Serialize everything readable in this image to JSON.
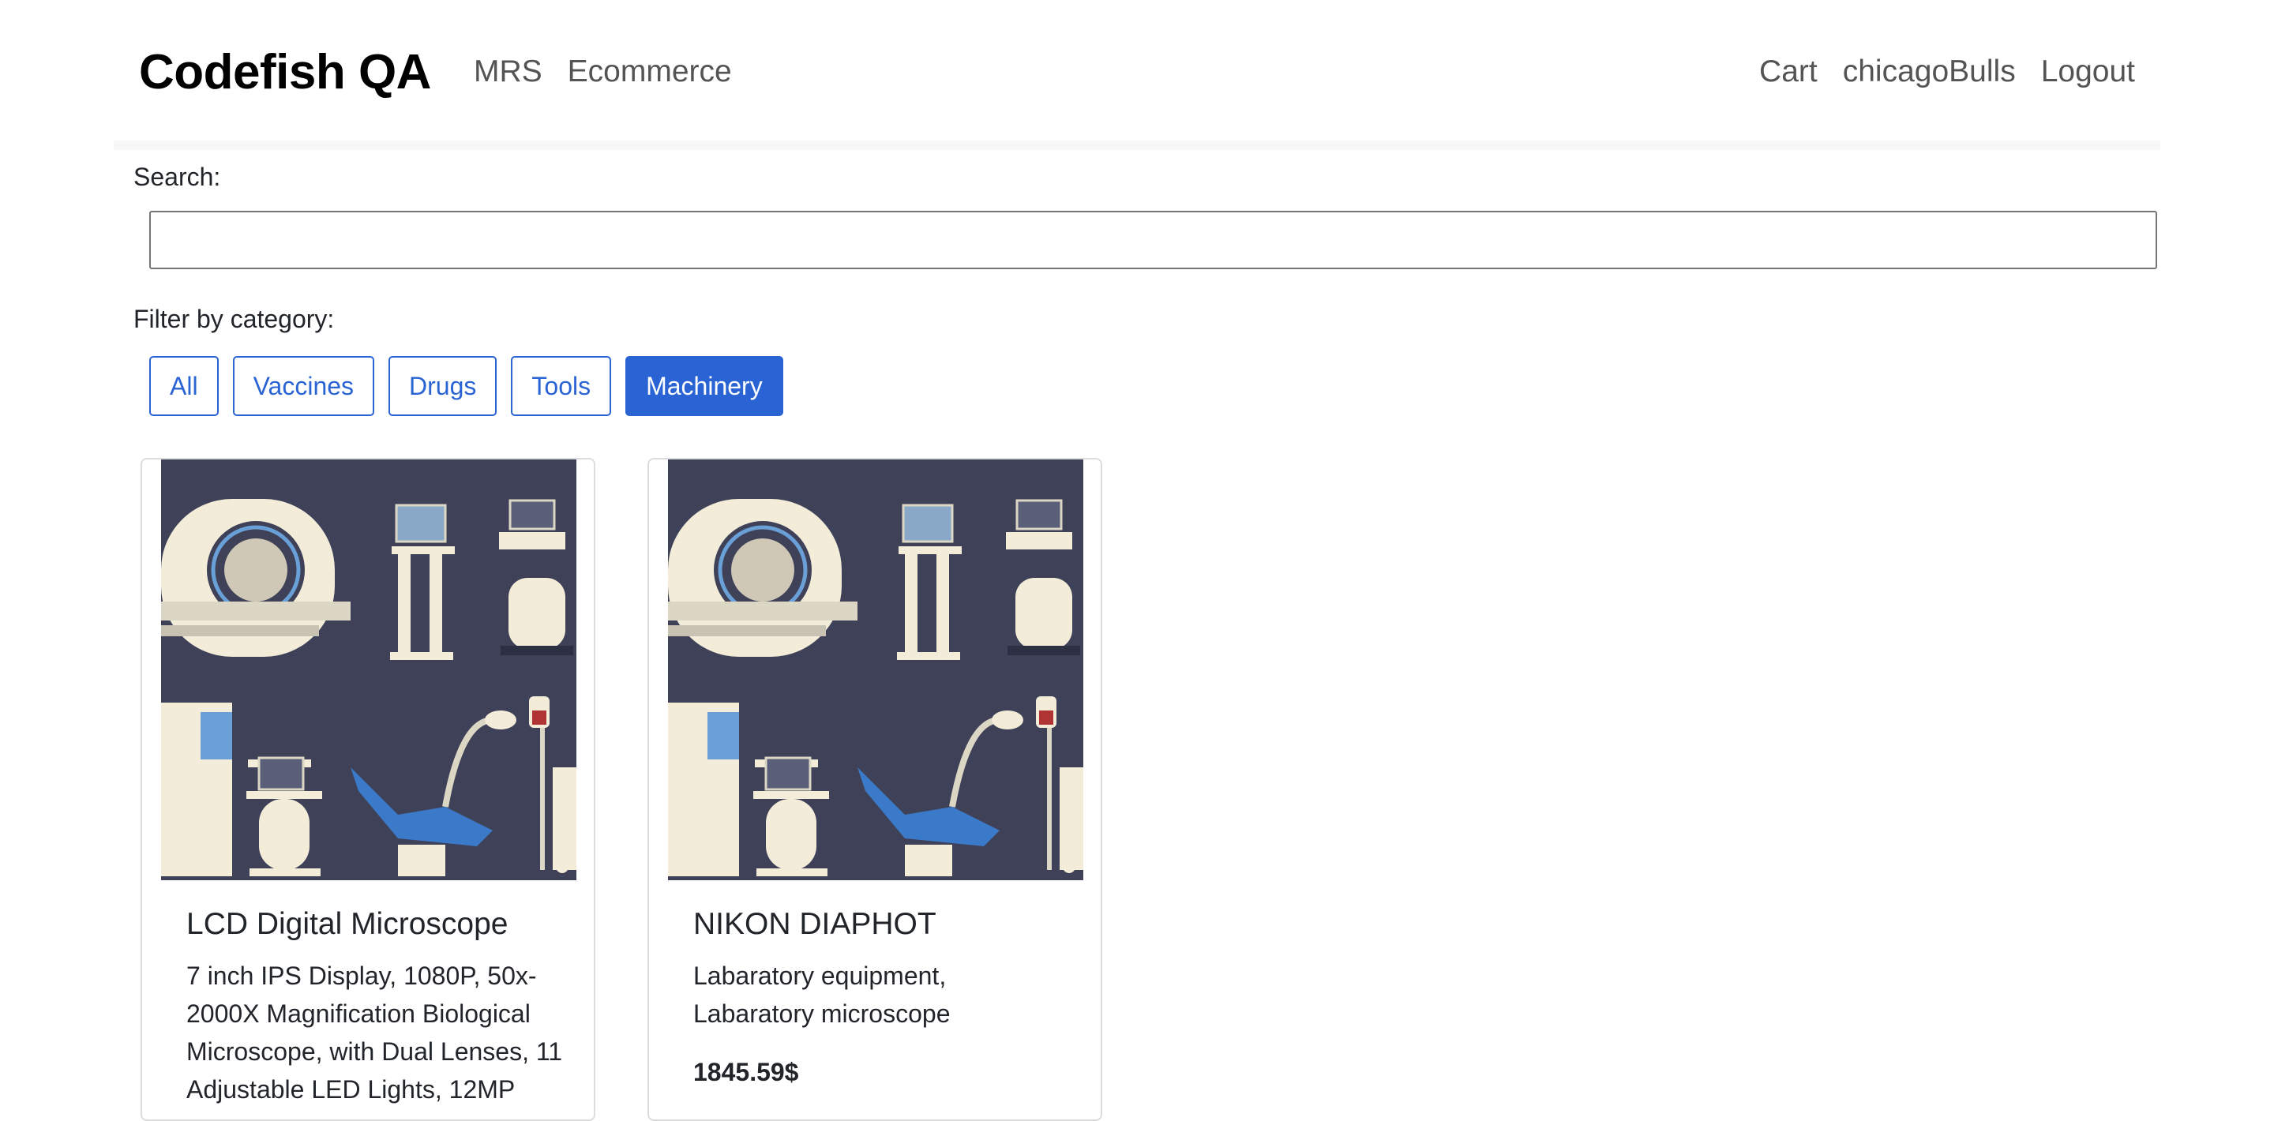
{
  "navbar": {
    "brand": "Codefish QA",
    "left_links": [
      "MRS",
      "Ecommerce"
    ],
    "right_links": [
      "Cart",
      "chicagoBulls",
      "Logout"
    ]
  },
  "search": {
    "label": "Search:",
    "value": "",
    "placeholder": ""
  },
  "filter": {
    "label": "Filter by category:",
    "options": [
      "All",
      "Vaccines",
      "Drugs",
      "Tools",
      "Machinery"
    ],
    "active": "Machinery"
  },
  "products": [
    {
      "title": "LCD Digital Microscope",
      "description": "7 inch IPS Display, 1080P, 50x-2000X Magnification Biological Microscope, with Dual Lenses, 11 Adjustable LED Lights, 12MP",
      "price": ""
    },
    {
      "title": "NIKON DIAPHOT",
      "description": "Labaratory equipment, Labaratory microscope",
      "price": "1845.59$"
    }
  ],
  "colors": {
    "accent": "#2a64d4",
    "image_bg": "#3e4157",
    "nav_text": "#545454"
  }
}
